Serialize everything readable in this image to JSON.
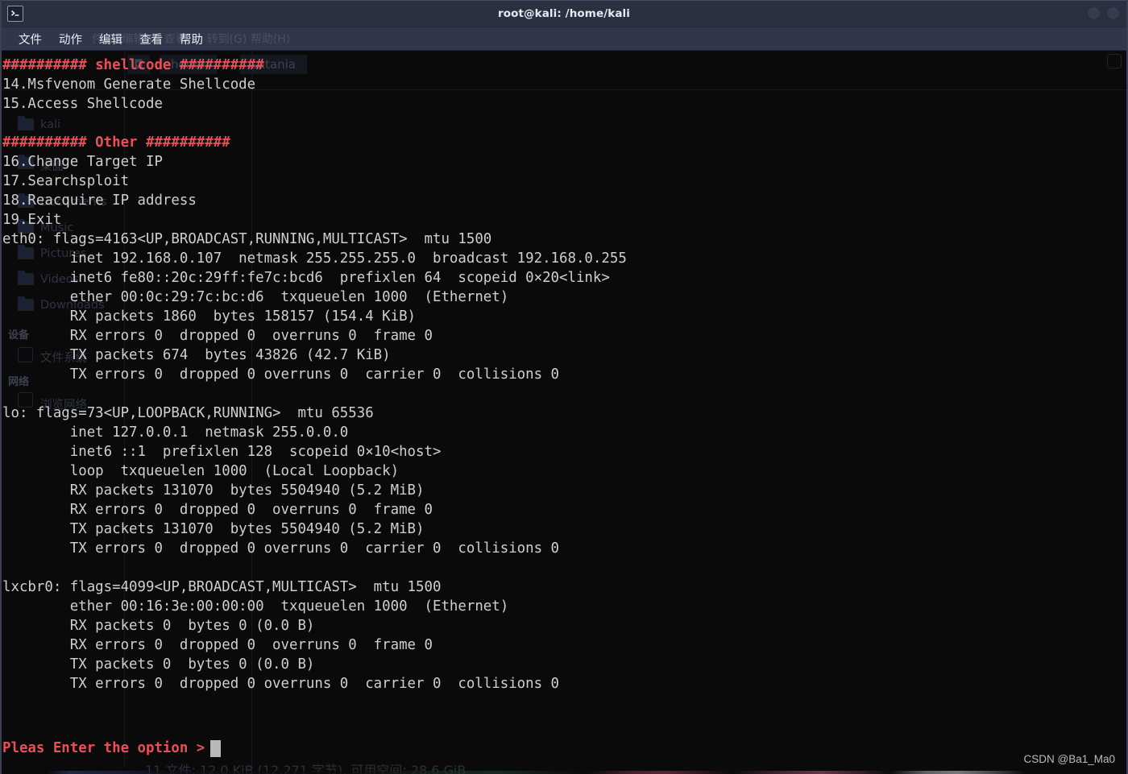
{
  "window": {
    "title": "root@kali: /home/kali",
    "icon": "terminal-icon",
    "buttons": [
      {
        "name": "minimize-button",
        "label": ""
      },
      {
        "name": "maximize-button",
        "label": ""
      }
    ]
  },
  "menubar": {
    "items": [
      {
        "name": "menu-file",
        "label": "文件"
      },
      {
        "name": "menu-actions",
        "label": "动作"
      },
      {
        "name": "menu-edit",
        "label": "编辑"
      },
      {
        "name": "menu-view",
        "label": "查看"
      },
      {
        "name": "menu-help",
        "label": "帮助"
      }
    ],
    "ghost_text": "件(F)  编辑(E)  查看(V)  转到(G)   帮助(H)"
  },
  "terminal": {
    "colors": {
      "background": "#0a0a0a",
      "foreground": "#cfcfcf",
      "red": "#ea4f58",
      "cursor": "#b8b8b8",
      "titlebar": "#2b3040",
      "menubar": "#31374a"
    },
    "lines": [
      {
        "text": "########## shellcode ##########",
        "style": "red"
      },
      {
        "text": "14.Msfvenom Generate Shellcode",
        "style": "normal"
      },
      {
        "text": "15.Access Shellcode",
        "style": "normal"
      },
      {
        "text": "",
        "style": "blank"
      },
      {
        "text": "########## Other ##########",
        "style": "red"
      },
      {
        "text": "16.Change Target IP",
        "style": "normal"
      },
      {
        "text": "17.Searchsploit",
        "style": "normal"
      },
      {
        "text": "18.Reacquire IP address",
        "style": "normal"
      },
      {
        "text": "19.Exit",
        "style": "normal"
      },
      {
        "text": "eth0: flags=4163<UP,BROADCAST,RUNNING,MULTICAST>  mtu 1500",
        "style": "normal"
      },
      {
        "text": "        inet 192.168.0.107  netmask 255.255.255.0  broadcast 192.168.0.255",
        "style": "normal"
      },
      {
        "text": "        inet6 fe80::20c:29ff:fe7c:bcd6  prefixlen 64  scopeid 0×20<link>",
        "style": "normal"
      },
      {
        "text": "        ether 00:0c:29:7c:bc:d6  txqueuelen 1000  (Ethernet)",
        "style": "normal"
      },
      {
        "text": "        RX packets 1860  bytes 158157 (154.4 KiB)",
        "style": "normal"
      },
      {
        "text": "        RX errors 0  dropped 0  overruns 0  frame 0",
        "style": "normal"
      },
      {
        "text": "        TX packets 674  bytes 43826 (42.7 KiB)",
        "style": "normal"
      },
      {
        "text": "        TX errors 0  dropped 0 overruns 0  carrier 0  collisions 0",
        "style": "normal"
      },
      {
        "text": "",
        "style": "blank"
      },
      {
        "text": "lo: flags=73<UP,LOOPBACK,RUNNING>  mtu 65536",
        "style": "normal"
      },
      {
        "text": "        inet 127.0.0.1  netmask 255.0.0.0",
        "style": "normal"
      },
      {
        "text": "        inet6 ::1  prefixlen 128  scopeid 0×10<host>",
        "style": "normal"
      },
      {
        "text": "        loop  txqueuelen 1000  (Local Loopback)",
        "style": "normal"
      },
      {
        "text": "        RX packets 131070  bytes 5504940 (5.2 MiB)",
        "style": "normal"
      },
      {
        "text": "        RX errors 0  dropped 0  overruns 0  frame 0",
        "style": "normal"
      },
      {
        "text": "        TX packets 131070  bytes 5504940 (5.2 MiB)",
        "style": "normal"
      },
      {
        "text": "        TX errors 0  dropped 0 overruns 0  carrier 0  collisions 0",
        "style": "normal"
      },
      {
        "text": "",
        "style": "blank"
      },
      {
        "text": "lxcbr0: flags=4099<UP,BROADCAST,MULTICAST>  mtu 1500",
        "style": "normal"
      },
      {
        "text": "        ether 00:16:3e:00:00:00  txqueuelen 1000  (Ethernet)",
        "style": "normal"
      },
      {
        "text": "        RX packets 0  bytes 0 (0.0 B)",
        "style": "normal"
      },
      {
        "text": "        RX errors 0  dropped 0  overruns 0  frame 0",
        "style": "normal"
      },
      {
        "text": "        TX packets 0  bytes 0 (0.0 B)",
        "style": "normal"
      },
      {
        "text": "        TX errors 0  dropped 0 overruns 0  carrier 0  collisions 0",
        "style": "normal"
      }
    ],
    "prompt": "Pleas Enter the option >",
    "cursor_visible": true
  },
  "ghost_window": {
    "breadcrumbs": [
      "home",
      "satania"
    ],
    "nav_icons": [
      "back-arrow-icon",
      "forward-arrow-icon",
      "up-arrow-icon",
      "home-icon"
    ],
    "sidebar": [
      {
        "label": "kali",
        "icon": "folder-icon"
      },
      {
        "label": "桌面",
        "icon": "folder-icon"
      },
      {
        "label": "Documents",
        "icon": "folder-icon"
      },
      {
        "label": "Music",
        "icon": "folder-icon"
      },
      {
        "label": "Pictures",
        "icon": "folder-icon"
      },
      {
        "label": "Videos",
        "icon": "folder-icon"
      },
      {
        "label": "Downloads",
        "icon": "download-icon"
      }
    ],
    "sidebar_groups": [
      {
        "header": "设备",
        "items": [
          {
            "label": "文件系统",
            "icon": "disk-icon"
          }
        ]
      },
      {
        "header": "网络",
        "items": [
          {
            "label": "浏览网络",
            "icon": "network-icon"
          }
        ]
      }
    ],
    "status_text": "11 文件: 12.0 KiB (12,271 字节), 可用空间: 28.6 GiB"
  },
  "watermark": {
    "text": "CSDN @Ba1_Ma0"
  }
}
